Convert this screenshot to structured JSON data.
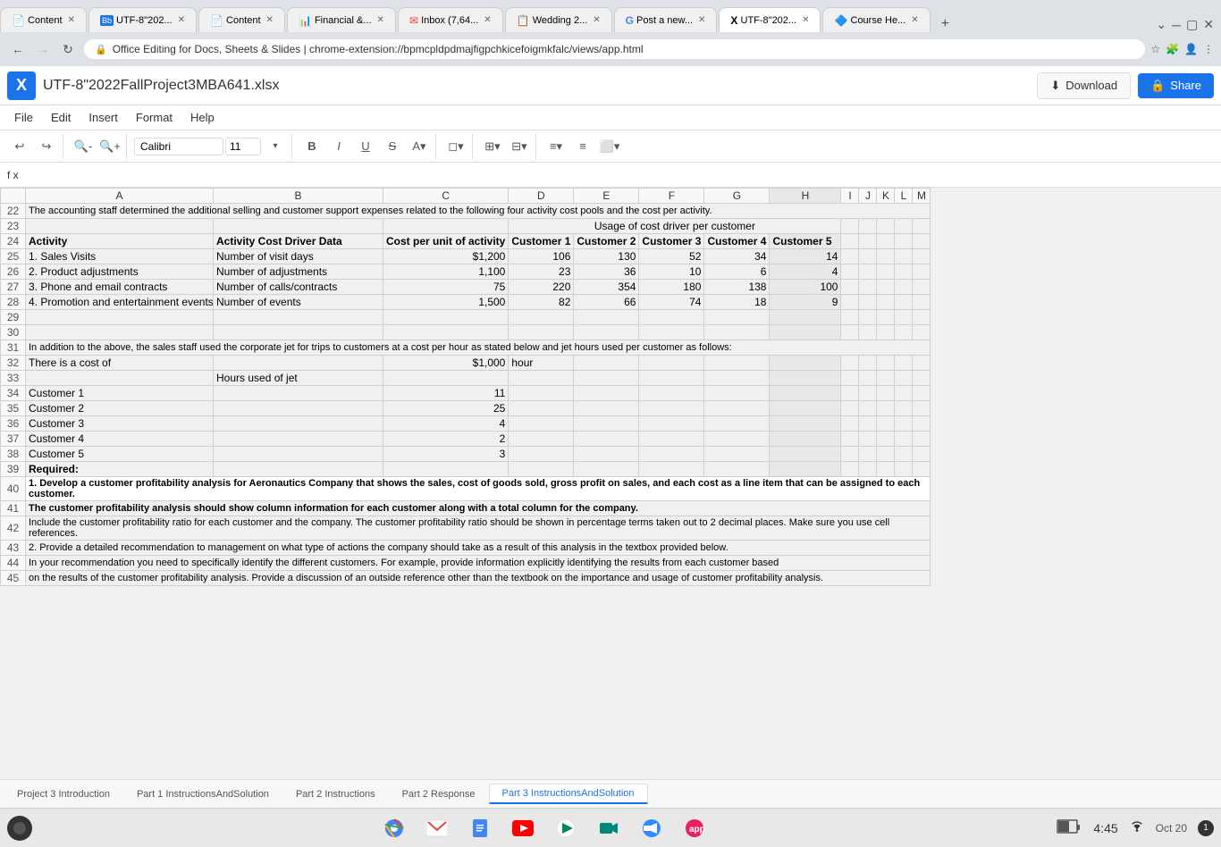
{
  "browser": {
    "tabs": [
      {
        "label": "Content",
        "active": false,
        "icon": "📄"
      },
      {
        "label": "UTF-8\"202...",
        "active": false,
        "icon": "Bb"
      },
      {
        "label": "Content",
        "active": false,
        "icon": "📄"
      },
      {
        "label": "Financial &...",
        "active": false,
        "icon": "📊"
      },
      {
        "label": "Inbox (7,64...",
        "active": false,
        "icon": "✉"
      },
      {
        "label": "Wedding 2...",
        "active": false,
        "icon": "📋"
      },
      {
        "label": "Post a new...",
        "active": false,
        "icon": "G"
      },
      {
        "label": "UTF-8\"202...",
        "active": true,
        "icon": "X"
      },
      {
        "label": "Course He...",
        "active": false,
        "icon": "🔷"
      }
    ],
    "url": "chrome-extension://bpmcpldpdmajfigpchkicefoigmkfalc/views/app.html",
    "display_url": "Office Editing for Docs, Sheets & Slides  |  chrome-extension://bpmcpldpdmajfigpchkicefoigmkfalc/views/app.html"
  },
  "app": {
    "title": "UTF-8\"2022FallProject3MBA641.xlsx",
    "logo": "X",
    "menu": [
      "File",
      "Edit",
      "Insert",
      "Format",
      "Help"
    ],
    "download_label": "Download",
    "share_label": "Share"
  },
  "toolbar": {
    "font": "Calibri",
    "size": "11"
  },
  "columns": [
    "",
    "A",
    "B",
    "C",
    "D",
    "E",
    "F",
    "G",
    "H",
    "I",
    "J",
    "K",
    "L",
    "M"
  ],
  "rows": [
    {
      "num": "22",
      "cells": {
        "A": "The accounting staff determined the additional selling and customer support expenses related to the following four activity cost pools and the cost per activity.",
        "B": "",
        "C": "",
        "D": "",
        "E": "",
        "F": "",
        "G": "",
        "H": "",
        "I": "",
        "J": "",
        "K": "",
        "L": "",
        "M": ""
      }
    },
    {
      "num": "23",
      "cells": {
        "A": "",
        "B": "",
        "C": "",
        "D": "Usage of cost driver per customer",
        "E": "",
        "F": "",
        "G": "",
        "H": "",
        "I": "",
        "J": "",
        "K": "",
        "L": "",
        "M": ""
      }
    },
    {
      "num": "24",
      "cells": {
        "A": "Activity",
        "B": "Activity Cost Driver Data",
        "C": "Cost per unit of activity",
        "D": "Customer 1",
        "E": "Customer 2",
        "F": "Customer 3",
        "G": "Customer 4",
        "H": "Customer 5",
        "I": "",
        "J": "",
        "K": "",
        "L": "",
        "M": ""
      }
    },
    {
      "num": "25",
      "cells": {
        "A": "1. Sales Visits",
        "B": "Number of visit days",
        "C": "$1,200",
        "D": "106",
        "E": "130",
        "F": "52",
        "G": "34",
        "H": "14",
        "I": "",
        "J": "",
        "K": "",
        "L": "",
        "M": ""
      }
    },
    {
      "num": "26",
      "cells": {
        "A": "2. Product adjustments",
        "B": "Number of adjustments",
        "C": "1,100",
        "D": "23",
        "E": "36",
        "F": "10",
        "G": "6",
        "H": "4",
        "I": "",
        "J": "",
        "K": "",
        "L": "",
        "M": ""
      }
    },
    {
      "num": "27",
      "cells": {
        "A": "3. Phone and email contracts",
        "B": "Number of calls/contracts",
        "C": "75",
        "D": "220",
        "E": "354",
        "F": "180",
        "G": "138",
        "H": "100",
        "I": "",
        "J": "",
        "K": "",
        "L": "",
        "M": ""
      }
    },
    {
      "num": "28",
      "cells": {
        "A": "4. Promotion and entertainment events",
        "B": "Number of events",
        "C": "1,500",
        "D": "82",
        "E": "66",
        "F": "74",
        "G": "18",
        "H": "9",
        "I": "",
        "J": "",
        "K": "",
        "L": "",
        "M": ""
      }
    },
    {
      "num": "29",
      "cells": {
        "A": "",
        "B": "",
        "C": "",
        "D": "",
        "E": "",
        "F": "",
        "G": "",
        "H": "",
        "I": "",
        "J": "",
        "K": "",
        "L": "",
        "M": ""
      }
    },
    {
      "num": "30",
      "cells": {
        "A": "",
        "B": "",
        "C": "",
        "D": "",
        "E": "",
        "F": "",
        "G": "",
        "H": "",
        "I": "",
        "J": "",
        "K": "",
        "L": "",
        "M": ""
      }
    },
    {
      "num": "31",
      "cells": {
        "A": "In addition to the above, the sales staff used the corporate jet for trips to customers at a cost per hour as stated below and jet hours used per customer as follows:",
        "B": "",
        "C": "",
        "D": "",
        "E": "",
        "F": "",
        "G": "",
        "H": "",
        "I": "",
        "J": "",
        "K": "",
        "L": "",
        "M": ""
      }
    },
    {
      "num": "32",
      "cells": {
        "A": "There is a cost of",
        "B": "",
        "C": "$1,000",
        "D": "hour",
        "E": "",
        "F": "",
        "G": "",
        "H": "",
        "I": "",
        "J": "",
        "K": "",
        "L": "",
        "M": ""
      }
    },
    {
      "num": "33",
      "cells": {
        "A": "",
        "B": "Hours used  of jet",
        "C": "",
        "D": "",
        "E": "",
        "F": "",
        "G": "",
        "H": "",
        "I": "",
        "J": "",
        "K": "",
        "L": "",
        "M": ""
      }
    },
    {
      "num": "34",
      "cells": {
        "A": "Customer 1",
        "B": "",
        "C": "11",
        "D": "",
        "E": "",
        "F": "",
        "G": "",
        "H": "",
        "I": "",
        "J": "",
        "K": "",
        "L": "",
        "M": ""
      }
    },
    {
      "num": "35",
      "cells": {
        "A": "Customer 2",
        "B": "",
        "C": "25",
        "D": "",
        "E": "",
        "F": "",
        "G": "",
        "H": "",
        "I": "",
        "J": "",
        "K": "",
        "L": "",
        "M": ""
      }
    },
    {
      "num": "36",
      "cells": {
        "A": "Customer 3",
        "B": "",
        "C": "4",
        "D": "",
        "E": "",
        "F": "",
        "G": "",
        "H": "",
        "I": "",
        "J": "",
        "K": "",
        "L": "",
        "M": ""
      }
    },
    {
      "num": "37",
      "cells": {
        "A": "Customer 4",
        "B": "",
        "C": "2",
        "D": "",
        "E": "",
        "F": "",
        "G": "",
        "H": "",
        "I": "",
        "J": "",
        "K": "",
        "L": "",
        "M": ""
      }
    },
    {
      "num": "38",
      "cells": {
        "A": "Customer 5",
        "B": "",
        "C": "3",
        "D": "",
        "E": "",
        "F": "",
        "G": "",
        "H": "",
        "I": "",
        "J": "",
        "K": "",
        "L": "",
        "M": ""
      }
    },
    {
      "num": "39",
      "cells": {
        "A": "Required:",
        "B": "",
        "C": "",
        "D": "",
        "E": "",
        "F": "",
        "G": "",
        "H": "",
        "I": "",
        "J": "",
        "K": "",
        "L": "",
        "M": ""
      }
    },
    {
      "num": "40",
      "cells": {
        "A": "1. Develop a customer profitability analysis for Aeronautics Company that shows the sales, cost of goods sold, gross profit on sales, and each cost as a line item that can be assigned to each customer.",
        "B": "",
        "C": "",
        "D": "",
        "E": "",
        "F": "",
        "G": "",
        "H": "",
        "I": "",
        "J": "",
        "K": "",
        "L": "",
        "M": ""
      }
    },
    {
      "num": "41",
      "cells": {
        "A": "The customer profitability analysis should show column information for each customer along with a total column for the company.",
        "B": "",
        "C": "",
        "D": "",
        "E": "",
        "F": "",
        "G": "",
        "H": "",
        "I": "",
        "J": "",
        "K": "",
        "L": "",
        "M": ""
      }
    },
    {
      "num": "42",
      "cells": {
        "A": "Include the customer profitability ratio for each customer and the company.  The customer profitability ratio should be shown in percentage terms taken out to 2 decimal places.   Make sure you use cell references.",
        "B": "",
        "C": "",
        "D": "",
        "E": "",
        "F": "",
        "G": "",
        "H": "",
        "I": "",
        "J": "",
        "K": "",
        "L": "",
        "M": ""
      }
    },
    {
      "num": "43",
      "cells": {
        "A": "2.  Provide a detailed recommendation to management on what type of actions the company should take as a result of this analysis in the textbox provided below.",
        "B": "",
        "C": "",
        "D": "",
        "E": "",
        "F": "",
        "G": "",
        "H": "",
        "I": "",
        "J": "",
        "K": "",
        "L": "",
        "M": ""
      }
    },
    {
      "num": "44",
      "cells": {
        "A": "In your recommendation you need to specifically identify the different customers.  For example,  provide information explicitly identifying the results from each customer based",
        "B": "",
        "C": "",
        "D": "",
        "E": "",
        "F": "",
        "G": "",
        "H": "",
        "I": "",
        "J": "",
        "K": "",
        "L": "",
        "M": ""
      }
    },
    {
      "num": "45",
      "cells": {
        "A": "on the results of the  customer profitability analysis.   Provide a discussion of an outside reference other than the textbook on the importance and usage of customer profitability analysis.",
        "B": "",
        "C": "",
        "D": "",
        "E": "",
        "F": "",
        "G": "",
        "H": "",
        "I": "",
        "J": "",
        "K": "",
        "L": "",
        "M": ""
      }
    }
  ],
  "sheet_tabs": [
    {
      "label": "Project 3 Introduction",
      "active": false
    },
    {
      "label": "Part 1 InstructionsAndSolution",
      "active": false
    },
    {
      "label": "Part 2 Instructions",
      "active": false
    },
    {
      "label": "Part 2 Response",
      "active": false
    },
    {
      "label": "Part 3 InstructionsAndSolution",
      "active": true
    }
  ],
  "taskbar": {
    "time": "4:45",
    "date": "Oct 20"
  }
}
